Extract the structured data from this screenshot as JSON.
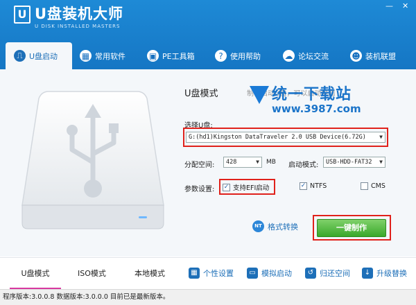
{
  "app": {
    "logo_letter": "U",
    "title": "U盘装机大师",
    "subtitle": "U DISK INSTALLED MASTERS",
    "win_min": "—",
    "win_close": "✕"
  },
  "nav": [
    {
      "label": "U盘启动",
      "icon": "usb-icon",
      "glyph": "⎍"
    },
    {
      "label": "常用软件",
      "icon": "apps-icon",
      "glyph": "▦"
    },
    {
      "label": "PE工具箱",
      "icon": "toolbox-icon",
      "glyph": "▣"
    },
    {
      "label": "使用帮助",
      "icon": "help-icon",
      "glyph": "?"
    },
    {
      "label": "论坛交流",
      "icon": "forum-icon",
      "glyph": "☁"
    },
    {
      "label": "装机联盟",
      "icon": "users-icon",
      "glyph": "☻"
    }
  ],
  "panel": {
    "mode_title": "U盘模式",
    "mode_desc": "制作启动U盘，可以启动电脑",
    "select_label": "选择U盘:",
    "device_value": "G:(hd1)Kingston DataTraveler 2.0 USB Device(6.72G)",
    "partition_label": "分配空间:",
    "partition_value": "428",
    "partition_unit": "MB",
    "boot_label": "启动模式:",
    "boot_value": "USB-HDD-FAT32",
    "params_label": "参数设置:",
    "efi_label": "支持EFI启动",
    "efi_checked": true,
    "ntfs_label": "NTFS",
    "ntfs_checked": true,
    "cms_label": "CMS",
    "cms_checked": false,
    "convert_badge": "NT",
    "convert_label": "格式转换",
    "oneclick_label": "一键制作"
  },
  "watermark": {
    "name": "统一下载站",
    "url": "www.3987.com"
  },
  "bottom_tabs": [
    "U盘模式",
    "ISO模式",
    "本地模式"
  ],
  "tools": [
    {
      "label": "个性设置",
      "icon": "grid-icon",
      "glyph": "▦"
    },
    {
      "label": "模拟启动",
      "icon": "monitor-icon",
      "glyph": "▭"
    },
    {
      "label": "归还空间",
      "icon": "restore-icon",
      "glyph": "↺"
    },
    {
      "label": "升级替换",
      "icon": "upgrade-icon",
      "glyph": "↓"
    }
  ],
  "status": "程序版本:3.0.0.8  数据版本:3.0.0.0 目前已是最新版本。",
  "colors": {
    "header": "#1576c4",
    "accent": "#1d6fb8",
    "highlight": "#e0211b",
    "button": "#3aa82b",
    "active_tab": "#d838a0"
  }
}
